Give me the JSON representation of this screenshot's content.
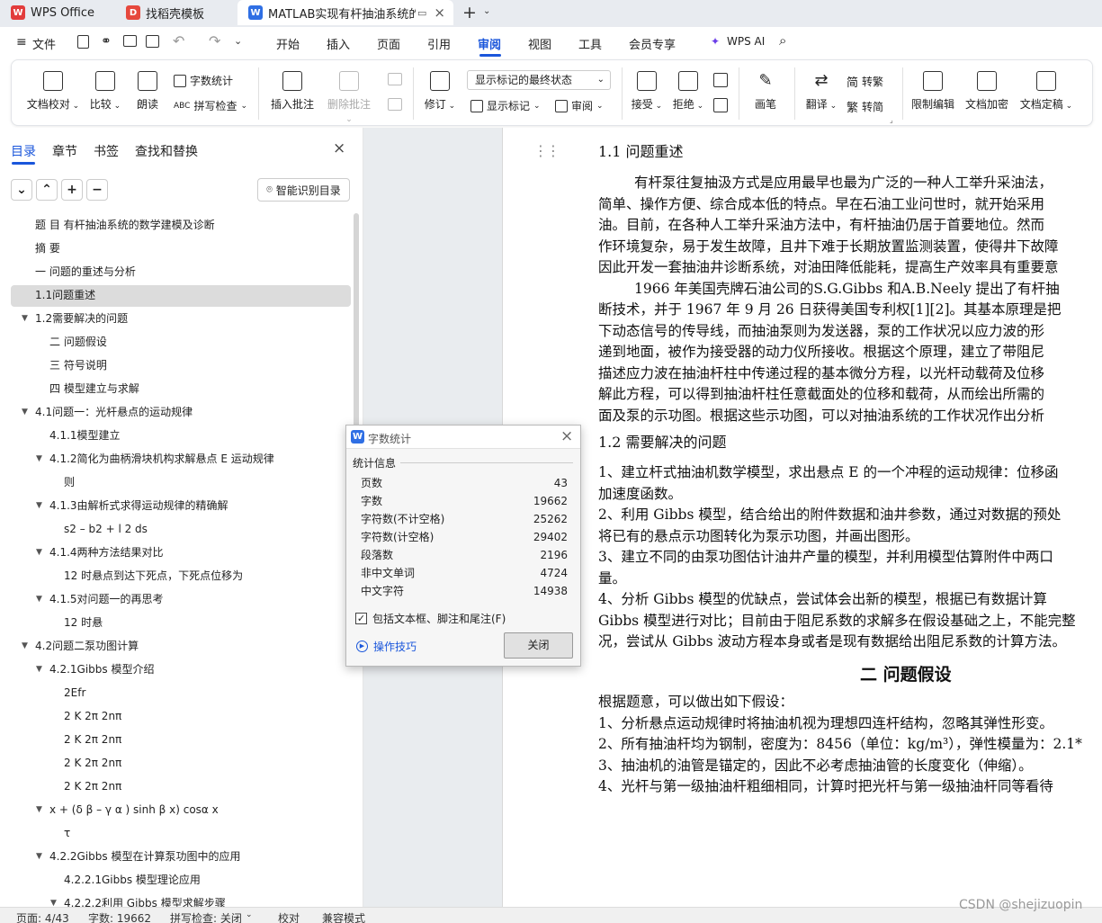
{
  "tabs": [
    {
      "label": "WPS Office",
      "logo": "W"
    },
    {
      "label": "找稻壳模板",
      "logo": "D"
    },
    {
      "label": "MATLAB实现有杆抽油系统的",
      "logo": "W"
    }
  ],
  "menu": {
    "file": "文件",
    "items": [
      "开始",
      "插入",
      "页面",
      "引用",
      "审阅",
      "视图",
      "工具",
      "会员专享"
    ],
    "active": "审阅",
    "wps_ai": "WPS AI"
  },
  "ribbon": {
    "doc_check": "文档校对",
    "compare": "比较",
    "read_aloud": "朗读",
    "word_count": "字数统计",
    "spell_check": "拼写检查",
    "insert_comment": "插入批注",
    "delete_comment": "删除批注",
    "revise": "修订",
    "display_state": "显示标记的最终状态",
    "show_marks": "显示标记",
    "review": "审阅",
    "accept": "接受",
    "reject": "拒绝",
    "pen": "画笔",
    "translate": "翻译",
    "to_traditional": "转繁",
    "to_simplified": "转简",
    "restrict_edit": "限制编辑",
    "encrypt": "文档加密",
    "finalize": "文档定稿"
  },
  "nav": {
    "tabs": [
      "目录",
      "章节",
      "书签",
      "查找和替换"
    ],
    "smart_btn": "智能识别目录",
    "toc": [
      {
        "label": "题 目  有杆抽油系统的数学建模及诊断",
        "level": 1,
        "arrow": false
      },
      {
        "label": "摘  要",
        "level": 1,
        "arrow": false
      },
      {
        "label": "一 问题的重述与分析",
        "level": 1,
        "arrow": false
      },
      {
        "label": "1.1问题重述",
        "level": 1,
        "arrow": false
      },
      {
        "label": "1.2需要解决的问题",
        "level": 1,
        "arrow": true
      },
      {
        "label": "二 问题假设",
        "level": 2,
        "arrow": false
      },
      {
        "label": "三 符号说明",
        "level": 2,
        "arrow": false
      },
      {
        "label": "四 模型建立与求解",
        "level": 2,
        "arrow": false
      },
      {
        "label": "4.1问题一：光杆悬点的运动规律",
        "level": 1,
        "arrow": true
      },
      {
        "label": "4.1.1模型建立",
        "level": 2,
        "arrow": false
      },
      {
        "label": "4.1.2简化为曲柄滑块机构求解悬点 E 运动规律",
        "level": 2,
        "arrow": true
      },
      {
        "label": "则",
        "level": 3,
        "arrow": false
      },
      {
        "label": "4.1.3由解析式求得运动规律的精确解",
        "level": 2,
        "arrow": true
      },
      {
        "label": "s2 – b2 + l 2 ds",
        "level": 3,
        "arrow": false
      },
      {
        "label": "4.1.4两种方法结果对比",
        "level": 2,
        "arrow": true
      },
      {
        "label": "12 时悬点到达下死点，下死点位移为",
        "level": 3,
        "arrow": false
      },
      {
        "label": "4.1.5对问题一的再思考",
        "level": 2,
        "arrow": true
      },
      {
        "label": "12 时悬",
        "level": 3,
        "arrow": false
      },
      {
        "label": "4.2问题二泵功图计算",
        "level": 1,
        "arrow": true
      },
      {
        "label": "4.2.1Gibbs 模型介绍",
        "level": 2,
        "arrow": true
      },
      {
        "label": "2Efr",
        "level": 3,
        "arrow": false
      },
      {
        "label": "2  K  2π  2nπ",
        "level": 3,
        "arrow": false
      },
      {
        "label": "2  K  2π  2nπ",
        "level": 3,
        "arrow": false
      },
      {
        "label": "2  K  2π  2nπ",
        "level": 3,
        "arrow": false
      },
      {
        "label": "2  K  2π  2nπ",
        "level": 3,
        "arrow": false
      },
      {
        "label": "x + (δ β – γ α ) sinh β x) cosα x",
        "level": 2,
        "arrow": true
      },
      {
        "label": "τ",
        "level": 3,
        "arrow": false
      },
      {
        "label": "4.2.2Gibbs 模型在计算泵功图中的应用",
        "level": 2,
        "arrow": true
      },
      {
        "label": "4.2.2.1Gibbs 模型理论应用",
        "level": 3,
        "arrow": false
      },
      {
        "label": "4.2.2.2利用 Gibbs 模型求解步骤",
        "level": 3,
        "arrow": true
      }
    ]
  },
  "doc": {
    "h11": "1.1 问题重述",
    "p1": [
      "有杆泵往复抽汲方式是应用最早也最为广泛的一种人工举升采油法，",
      "简单、操作方便、综合成本低的特点。早在石油工业问世时，就开始采用",
      "油。目前，在各种人工举升采油方法中，有杆抽油仍居于首要地位。然而",
      "作环境复杂，易于发生故障，且井下难于长期放置监测装置，使得井下故障",
      "因此开发一套抽油井诊断系统，对油田降低能耗，提高生产效率具有重要意",
      "1966 年美国壳牌石油公司的S.G.Gibbs 和A.B.Neely 提出了有杆抽",
      "断技术，并于 1967 年 9 月 26 日获得美国专利权[1][2]。其基本原理是把",
      "下动态信号的传导线，而抽油泵则为发送器，泵的工作状况以应力波的形",
      "递到地面，被作为接受器的动力仪所接收。根据这个原理，建立了带阻尼",
      "描述应力波在抽油杆柱中传递过程的基本微分方程，以光杆动载荷及位移",
      "解此方程，可以得到抽油杆柱任意截面处的位移和载荷，从而绘出所需的",
      "面及泵的示功图。根据这些示功图，可以对抽油系统的工作状况作出分析"
    ],
    "h12": "1.2 需要解决的问题",
    "p2": [
      "1、建立杆式抽油机数学模型，求出悬点 E 的一个冲程的运动规律：位移函",
      "加速度函数。",
      "2、利用 Gibbs 模型，结合给出的附件数据和油井参数，通过对数据的预处",
      "将已有的悬点示功图转化为泵示功图，并画出图形。",
      "3、建立不同的由泵功图估计油井产量的模型，并利用模型估算附件中两口",
      "量。",
      "4、分析 Gibbs 模型的优缺点，尝试体会出新的模型，根据已有数据计算",
      "Gibbs 模型进行对比；目前由于阻尼系数的求解多在假设基础之上，不能完整",
      "况，尝试从 Gibbs 波动方程本身或者是现有数据给出阻尼系数的计算方法。"
    ],
    "h2": "二  问题假设",
    "p3": [
      "根据题意，可以做出如下假设：",
      "1、分析悬点运动规律时将抽油机视为理想四连杆结构，忽略其弹性形变。",
      "2、所有抽油杆均为钢制，密度为：8456（单位：kg/m³），弹性模量为：2.1*",
      "3、抽油机的油管是锚定的，因此不必考虑抽油管的长度变化（伸缩）。",
      "4、光杆与第一级抽油杆粗细相同，计算时把光杆与第一级抽油杆同等看待"
    ]
  },
  "dialog": {
    "title": "字数统计",
    "section": "统计信息",
    "rows": [
      {
        "label": "页数",
        "value": "43"
      },
      {
        "label": "字数",
        "value": "19662"
      },
      {
        "label": "字符数(不计空格)",
        "value": "25262"
      },
      {
        "label": "字符数(计空格)",
        "value": "29402"
      },
      {
        "label": "段落数",
        "value": "2196"
      },
      {
        "label": "非中文单词",
        "value": "4724"
      },
      {
        "label": "中文字符",
        "value": "14938"
      }
    ],
    "checkbox": "包括文本框、脚注和尾注(F)",
    "tips": "操作技巧",
    "close": "关闭"
  },
  "status": {
    "page": "页面: 4/43",
    "words": "字数: 19662",
    "spell": "拼写检查: 关闭",
    "proof": "校对",
    "compat": "兼容模式"
  },
  "watermark": "CSDN @shejizuopin",
  "colors": {
    "accent": "#1a56db",
    "wps_red": "#e23c3c"
  }
}
